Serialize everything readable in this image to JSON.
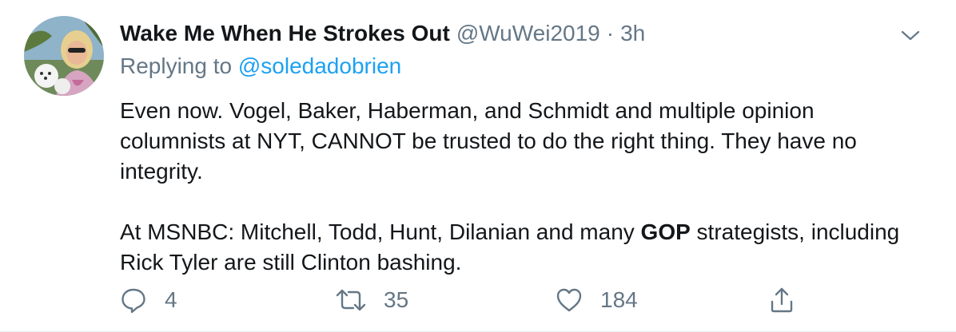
{
  "tweet": {
    "display_name": "Wake Me When He Strokes Out",
    "handle": "@WuWei2019",
    "separator": "·",
    "time": "3h",
    "replying_prefix": "Replying to",
    "replying_to": "@soledadobrien",
    "paragraph1": "Even now. Vogel, Baker, Haberman, and Schmidt and multiple opinion columnists at NYT, CANNOT be trusted to do the right thing. They have no integrity.",
    "paragraph2_before": "At MSNBC: Mitchell, Todd, Hunt, Dilanian and many ",
    "paragraph2_bold": "GOP",
    "paragraph2_after": " strategists, including Rick Tyler are still Clinton bashing."
  },
  "actions": {
    "reply_count": "4",
    "retweet_count": "35",
    "like_count": "184"
  },
  "icons": {
    "caret": "chevron-down-icon",
    "reply": "reply-icon",
    "retweet": "retweet-icon",
    "like": "heart-icon",
    "share": "share-icon"
  },
  "colors": {
    "text": "#14171a",
    "secondary": "#657786",
    "link": "#1da1f2"
  }
}
